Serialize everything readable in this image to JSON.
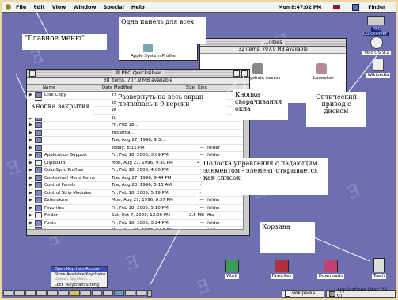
{
  "menubar": {
    "items": [
      "File",
      "Edit",
      "View",
      "Window",
      "Special",
      "Help"
    ],
    "clock": "Mon 8:47:02 PM",
    "app_name": "Finder"
  },
  "callouts": {
    "main_menu": "\"Главное меню\"",
    "one_panel": "Одна панель для всех",
    "close_button": "Кнопка закрытия",
    "maximize": "Развернуть на весь экран - появилась в 9 версии",
    "collapse": "Кнопка сворачивания окна",
    "optical_drive": "Оптический привод с диском",
    "control_strip": "Полоска управления с падающим элементом - элемент открывается как список",
    "trash": "Корзина"
  },
  "finder_window": {
    "title": "PPC Quicksilver",
    "info": "38 items, 707.9 MB available",
    "columns": {
      "name": "Name",
      "date": "Date Modified",
      "size": "Size",
      "kind": "Kind"
    },
    "rows": [
      {
        "name": "Disk Copy",
        "date": "Thu, Jan 6, ..."
      },
      {
        "name": "",
        "date": "Today, 8:..."
      },
      {
        "name": "",
        "date": "Wed, Aug..."
      },
      {
        "name": "",
        "date": "Tue, Aug 2..."
      },
      {
        "name": "",
        "date": "Fri, Feb 18..."
      },
      {
        "name": "",
        "date": "Yesterda..."
      },
      {
        "name": "",
        "date": "Tue, Aug 27, 1996, 9:3..."
      },
      {
        "name": "",
        "date": "Today, 8:15 PM",
        "size": "—",
        "kind": "folder"
      },
      {
        "name": "Application Support",
        "date": "Fri, Feb 18, 2005, 3:09 PM",
        "size": "—",
        "kind": "folder"
      },
      {
        "name": "Clipboard",
        "date": "Mon, Aug 27, 1996, 9:30 PM",
        "size": "4 K",
        "kind": "file"
      },
      {
        "name": "ColorSync Profiles",
        "date": "Fri, Feb 18, 2005, 4:06 PM",
        "size": "—",
        "kind": "folder"
      },
      {
        "name": "Contextual Menu Items",
        "date": "Tue, Aug 27, 1996, 9:44 PM",
        "size": "—",
        "kind": "folder"
      },
      {
        "name": "Control Panels",
        "date": "Tue, Aug 28, 1996, 5:15 AM",
        "size": "—",
        "kind": "folder"
      },
      {
        "name": "Control Strip Modules",
        "date": "Fri, Feb 18, 2005, 5:19 PM",
        "size": "—",
        "kind": "folder"
      },
      {
        "name": "Extensions",
        "date": "Mon, Aug 27, 1996, 8:37 PM",
        "size": "—",
        "kind": "folder"
      },
      {
        "name": "Favorites",
        "date": "Fri, Feb 18, 2005, 5:10 PM",
        "size": "—",
        "kind": "folder"
      },
      {
        "name": "Finder",
        "date": "Sat, Oct 7, 2000, 12:00 PM",
        "size": "2.5 MB",
        "kind": "file"
      },
      {
        "name": "Fonts",
        "date": "Fri, Feb 18, 2005, 3:24 PM",
        "size": "—",
        "kind": "folder"
      },
      {
        "name": "Help",
        "date": "Mon, Aug 27, 1996, 9:12 PM",
        "size": "—",
        "kind": "folder"
      }
    ]
  },
  "utilities_window": {
    "title": "...ilities",
    "info": "32 items, 707.9 MB available",
    "items": [
      "Apple System Profiler",
      "Keychain Access",
      "Launcher"
    ]
  },
  "desktop_icons": {
    "disk": "PPC Quicksilver",
    "cd": "Mac OS 9.1",
    "wikipedia": "Wikipedia",
    "work": "Work",
    "favorites": "Favorites",
    "downloads": "Downloads",
    "trash": "Trash"
  },
  "popup_menu": [
    "Open Keychain Access",
    "Show Available Keychains",
    "Unlock Keychain...",
    "Lock \"Keychain Strong\""
  ],
  "taskbar": {
    "wikipedia": "Wikipedia",
    "applications": "Applications (Mac OS 9)"
  }
}
